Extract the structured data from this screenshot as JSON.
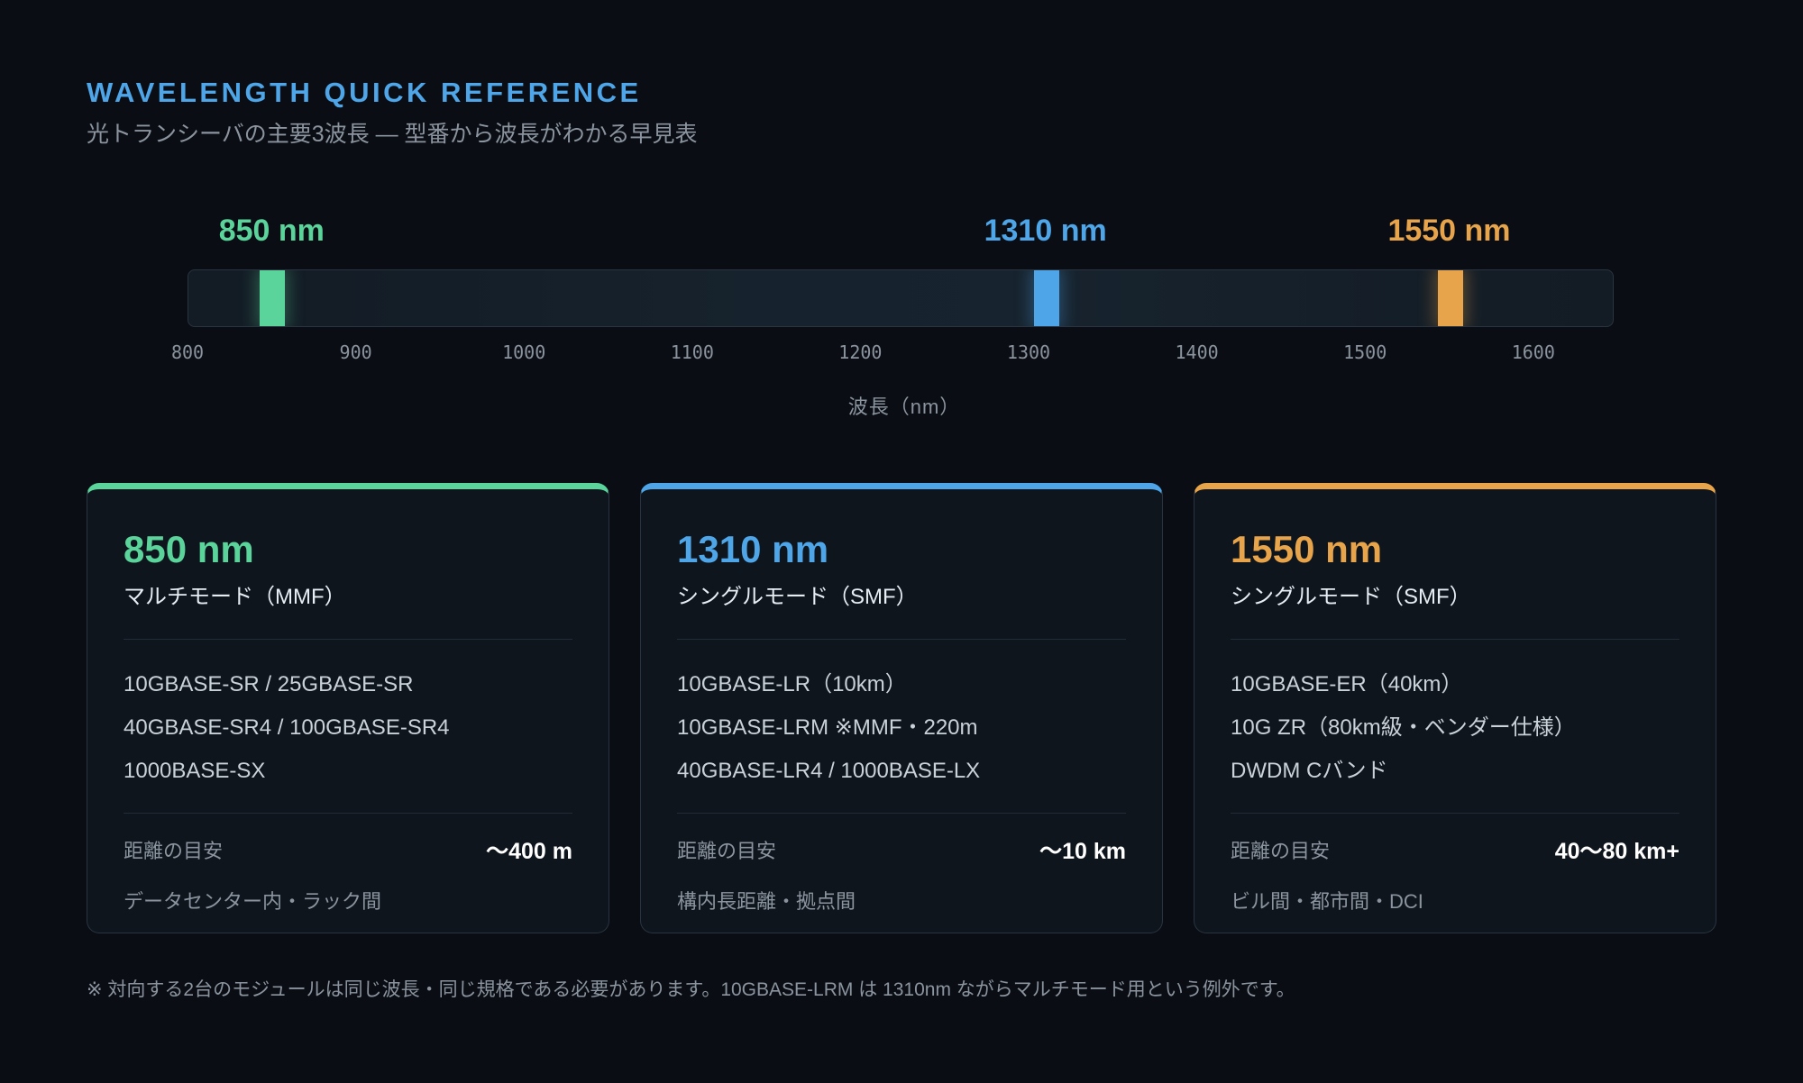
{
  "header": {
    "kicker": "WAVELENGTH QUICK REFERENCE",
    "subtitle": "光トランシーバの主要3波長 — 型番から波長がわかる早見表"
  },
  "spectrum": {
    "axis_min": 800,
    "axis_max": 1650,
    "ticks": [
      "800",
      "900",
      "1000",
      "1100",
      "1200",
      "1300",
      "1400",
      "1500",
      "1600"
    ],
    "tick_values": [
      800,
      900,
      1000,
      1100,
      1200,
      1300,
      1400,
      1500,
      1600
    ],
    "axis_label": "波長（nm）",
    "bands": [
      {
        "value": 850,
        "label": "850 nm",
        "color": "#5ad49a"
      },
      {
        "value": 1310,
        "label": "1310 nm",
        "color": "#4ea6e8"
      },
      {
        "value": 1550,
        "label": "1550 nm",
        "color": "#e8a44a"
      }
    ]
  },
  "cards": [
    {
      "title": "850 nm",
      "mode": "マルチモード（MMF）",
      "color": "#5ad49a",
      "standards": [
        "10GBASE-SR / 25GBASE-SR",
        "40GBASE-SR4 / 100GBASE-SR4",
        "1000BASE-SX"
      ],
      "distance_label": "距離の目安",
      "distance_value": "〜400 m",
      "use": "データセンター内・ラック間"
    },
    {
      "title": "1310 nm",
      "mode": "シングルモード（SMF）",
      "color": "#4ea6e8",
      "standards": [
        "10GBASE-LR（10km）",
        "10GBASE-LRM ※MMF・220m",
        "40GBASE-LR4 / 1000BASE-LX"
      ],
      "distance_label": "距離の目安",
      "distance_value": "〜10 km",
      "use": "構内長距離・拠点間"
    },
    {
      "title": "1550 nm",
      "mode": "シングルモード（SMF）",
      "color": "#e8a44a",
      "standards": [
        "10GBASE-ER（40km）",
        "10G ZR（80km級・ベンダー仕様）",
        "DWDM Cバンド"
      ],
      "distance_label": "距離の目安",
      "distance_value": "40〜80 km+",
      "use": "ビル間・都市間・DCI"
    }
  ],
  "footnote": "※ 対向する2台のモジュールは同じ波長・同じ規格である必要があります。10GBASE-LRM は 1310nm ながらマルチモード用という例外です。"
}
